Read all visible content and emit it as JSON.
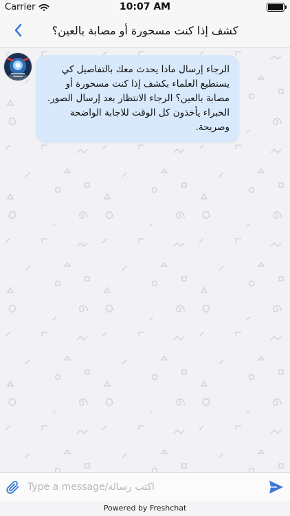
{
  "status_bar": {
    "carrier": "Carrier",
    "time": "10:07 AM"
  },
  "nav": {
    "title": "كشف إذا كنت مسحورة أو مصابة بالعين؟",
    "back_icon": "chevron-left-icon"
  },
  "message": {
    "text": "الرجاء إرسال ماذا يحدث معك بالتفاصيل كي يستطيع العلماء بكشف إذا كنت مسحورة أو مصابة بالعين؟ الرجاء الانتظار بعد إرسال الصور. الخبراء يأخذون كل الوقت للاجابة الواضحة وصريحة."
  },
  "composer": {
    "placeholder": "Type a message/اكتب رسالة",
    "attach_icon": "paperclip-icon",
    "send_icon": "send-icon"
  },
  "footer": {
    "powered_by": "Powered by Freshchat"
  },
  "colors": {
    "accent": "#3b79d6",
    "bubble": "#d8e9fb",
    "background": "#f2f2f5"
  }
}
